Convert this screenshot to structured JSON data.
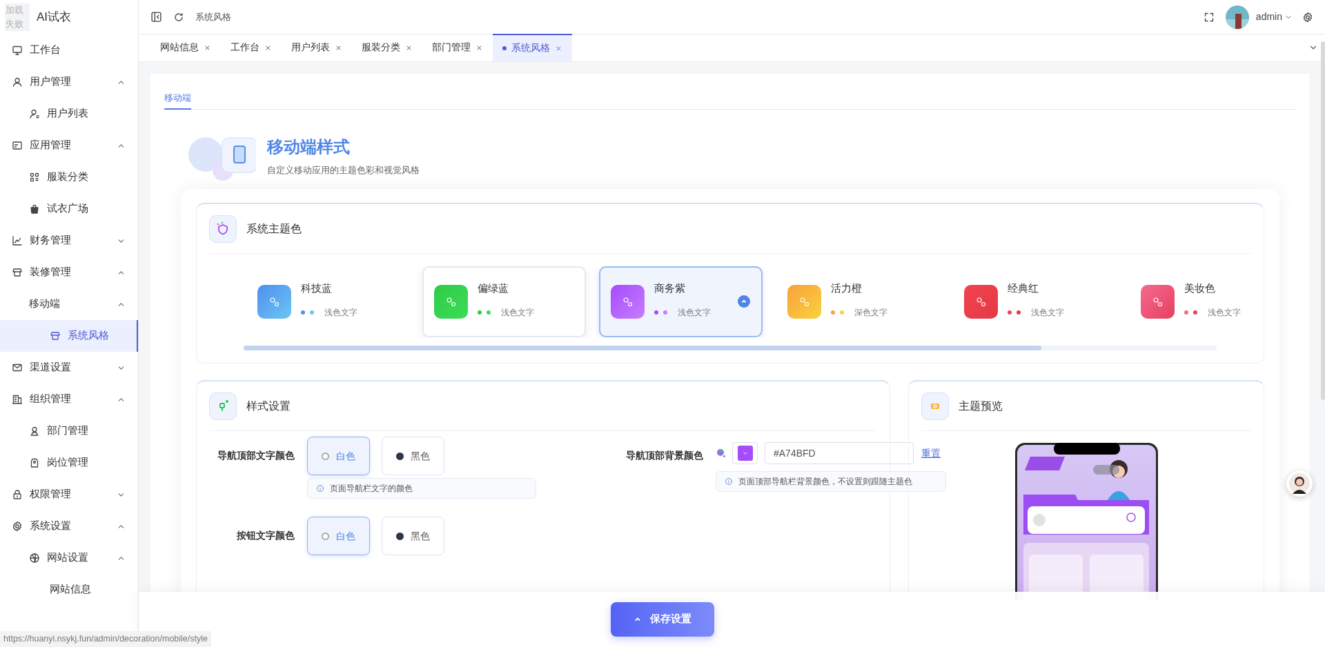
{
  "logo": {
    "image_alt": "加载失败",
    "title": "AI试衣"
  },
  "sidebar": {
    "items": [
      {
        "label": "工作台",
        "selected": false
      },
      {
        "label": "用户管理",
        "expanded": true,
        "children": [
          {
            "label": "用户列表",
            "selected": false
          }
        ]
      },
      {
        "label": "应用管理",
        "expanded": true,
        "children": [
          {
            "label": "服装分类",
            "selected": false
          },
          {
            "label": "试衣广场",
            "selected": false
          }
        ]
      },
      {
        "label": "财务管理",
        "expanded": false
      },
      {
        "label": "装修管理",
        "expanded": true,
        "children": [
          {
            "label": "移动端",
            "expanded": true,
            "children": [
              {
                "label": "系统风格",
                "selected": true
              }
            ]
          }
        ]
      },
      {
        "label": "渠道设置",
        "expanded": false
      },
      {
        "label": "组织管理",
        "expanded": true,
        "children": [
          {
            "label": "部门管理",
            "selected": false
          },
          {
            "label": "岗位管理",
            "selected": false
          }
        ]
      },
      {
        "label": "权限管理",
        "expanded": false
      },
      {
        "label": "系统设置",
        "expanded": true,
        "children": [
          {
            "label": "网站设置",
            "expanded": true,
            "children": [
              {
                "label": "网站信息",
                "selected": false
              }
            ]
          }
        ]
      }
    ]
  },
  "header": {
    "breadcrumb": "系统风格",
    "user": "admin"
  },
  "tabs": [
    {
      "label": "网站信息",
      "selected": false
    },
    {
      "label": "工作台",
      "selected": false
    },
    {
      "label": "用户列表",
      "selected": false
    },
    {
      "label": "服装分类",
      "selected": false
    },
    {
      "label": "部门管理",
      "selected": false
    },
    {
      "label": "系统风格",
      "selected": true
    }
  ],
  "page_tabs": [
    {
      "label": "移动端",
      "selected": true
    }
  ],
  "page_header": {
    "title": "移动端样式",
    "subtitle": "自定义移动应用的主题色彩和视觉风格"
  },
  "theme_section": {
    "title": "系统主题色",
    "themes": [
      {
        "name": "科技蓝",
        "note": "浅色文字",
        "dots": [
          {
            "color": "#4f8ff0"
          },
          {
            "color": "#6cc6f2"
          }
        ],
        "selected": false,
        "hovered": false
      },
      {
        "name": "偏绿蓝",
        "note": "浅色文字",
        "dots": [
          {
            "color": "#2fcb48"
          },
          {
            "color": "#3ddc55"
          }
        ],
        "selected": false,
        "hovered": true
      },
      {
        "name": "商务紫",
        "note": "浅色文字",
        "dots": [
          {
            "color": "#a64bfb"
          },
          {
            "color": "#c77dff"
          }
        ],
        "selected": true,
        "hovered": false
      },
      {
        "name": "活力橙",
        "note": "深色文字",
        "dots": [
          {
            "color": "#f7a23b"
          },
          {
            "color": "#fbd13d"
          }
        ],
        "selected": false,
        "hovered": false
      },
      {
        "name": "经典红",
        "note": "浅色文字",
        "dots": [
          {
            "color": "#f0434f"
          },
          {
            "color": "#e63946"
          }
        ],
        "selected": false,
        "hovered": false
      },
      {
        "name": "美妆色",
        "note": "浅色文字",
        "dots": [
          {
            "color": "#f56a8e"
          },
          {
            "color": "#e6405e"
          }
        ],
        "selected": false,
        "hovered": false
      }
    ]
  },
  "style_section": {
    "title": "样式设置",
    "nav_text_color": {
      "label": "导航顶部文字颜色",
      "options": [
        {
          "label": "白色",
          "selected": true
        },
        {
          "label": "黑色",
          "selected": false
        }
      ],
      "hint": "页面导航栏文字的颜色"
    },
    "button_text_color": {
      "label": "按钮文字颜色",
      "options": [
        {
          "label": "白色",
          "selected": true
        },
        {
          "label": "黑色",
          "selected": false
        }
      ]
    },
    "nav_bg_color": {
      "label": "导航顶部背景颜色",
      "color": "#a74bfd",
      "value": "#A74BFD",
      "reset": "重置",
      "hint": "页面顶部导航栏背景颜色，不设置则跟随主题色"
    }
  },
  "preview_section": {
    "title": "主题预览"
  },
  "save_button": "保存设置",
  "status_url": "https://huanyi.nsykj.fun/admin/decoration/mobile/style"
}
